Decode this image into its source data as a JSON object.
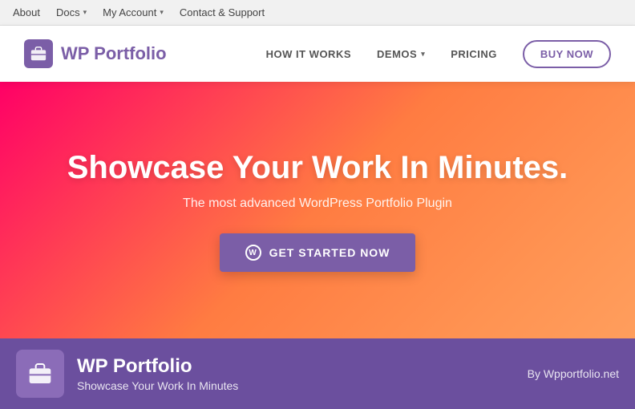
{
  "admin_bar": {
    "items": [
      {
        "label": "About",
        "has_chevron": false
      },
      {
        "label": "Docs",
        "has_chevron": true
      },
      {
        "label": "My Account",
        "has_chevron": true
      },
      {
        "label": "Contact & Support",
        "has_chevron": false
      }
    ]
  },
  "nav": {
    "logo_text_wp": "WP",
    "logo_text_portfolio": " Portfolio",
    "links": [
      {
        "label": "HOW IT WORKS",
        "has_chevron": false
      },
      {
        "label": "DEMOS",
        "has_chevron": true
      },
      {
        "label": "PRICING",
        "has_chevron": false
      }
    ],
    "cta_label": "BUY NOW"
  },
  "hero": {
    "title": "Showcase Your Work In Minutes.",
    "subtitle": "The most advanced WordPress Portfolio Plugin",
    "cta_label": "GET STARTED NOW",
    "wp_icon": "W"
  },
  "bottom_bar": {
    "plugin_name": "WP Portfolio",
    "plugin_tagline": "Showcase Your Work In Minutes",
    "plugin_by": "By Wpportfolio.net",
    "icon": "💼"
  },
  "colors": {
    "purple": "#7b5ea7",
    "dark_purple": "#6b4f9e"
  }
}
